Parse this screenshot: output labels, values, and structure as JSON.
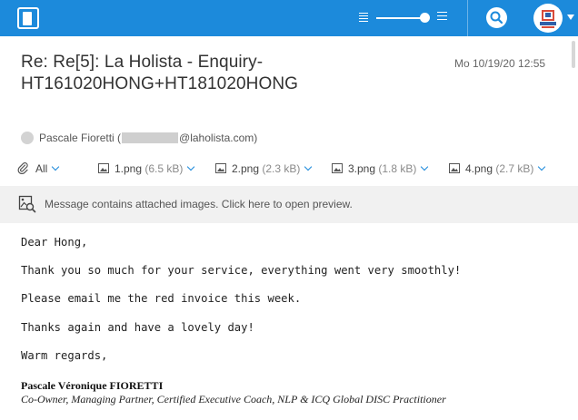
{
  "header": {
    "subject": "Re: Re[5]: La Holista - Enquiry-HT161020HONG+HT181020HONG",
    "date": "Mo 10/19/20 12:55"
  },
  "sender": {
    "name": "Pascale Fioretti (",
    "email_domain": "@laholista.com)"
  },
  "attachments": {
    "all_label": "All",
    "files": [
      {
        "name": "1.png",
        "size": "(6.5 kB)"
      },
      {
        "name": "2.png",
        "size": "(2.3 kB)"
      },
      {
        "name": "3.png",
        "size": "(1.8 kB)"
      },
      {
        "name": "4.png",
        "size": "(2.7 kB)"
      }
    ]
  },
  "banner": {
    "text": "Message contains attached images. Click here to open preview."
  },
  "message": {
    "lines": [
      "Dear Hong,",
      "Thank you so much for your service, everything went very smoothly!",
      "Please email me the red invoice this week.",
      "Thanks again and have a lovely day!",
      "Warm regards,"
    ],
    "signature_name": "Pascale Véronique FIORETTI",
    "signature_title": "Co-Owner, Managing Partner, Certified Executive Coach, NLP & ICQ Global DISC Practitioner"
  },
  "colors": {
    "topbar": "#1c8adb",
    "accent": "#1c8adb",
    "banner_bg": "#f1f1f1"
  },
  "icons": [
    "sidebar-toggle-icon",
    "density-icon",
    "search-icon",
    "avatar-logo",
    "chevron-down-icon",
    "paperclip-icon",
    "image-icon",
    "image-preview-icon"
  ]
}
